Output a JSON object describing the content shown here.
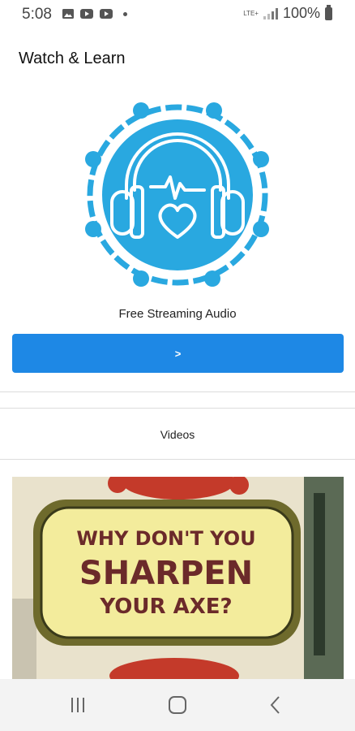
{
  "status_bar": {
    "time": "5:08",
    "network_label": "LTE+",
    "battery_percent": "100%",
    "icons": [
      "gallery-icon",
      "youtube-icon",
      "youtube-icon",
      "notification-dot-icon",
      "signal-icon",
      "battery-icon"
    ]
  },
  "header": {
    "title": "Watch & Learn"
  },
  "audio": {
    "caption": "Free Streaming Audio",
    "button_label": ">",
    "logo_icon": "headphones-heart-logo-icon",
    "accent_color": "#1e88e5",
    "logo_color": "#29a8e0"
  },
  "videos": {
    "section_label": "Videos",
    "thumbnail_text": [
      "WHY DON'T YOU",
      "SHARPEN",
      "YOUR AXE?"
    ]
  },
  "nav_bar": {
    "buttons": [
      "recent-apps-icon",
      "home-icon",
      "back-icon"
    ]
  }
}
